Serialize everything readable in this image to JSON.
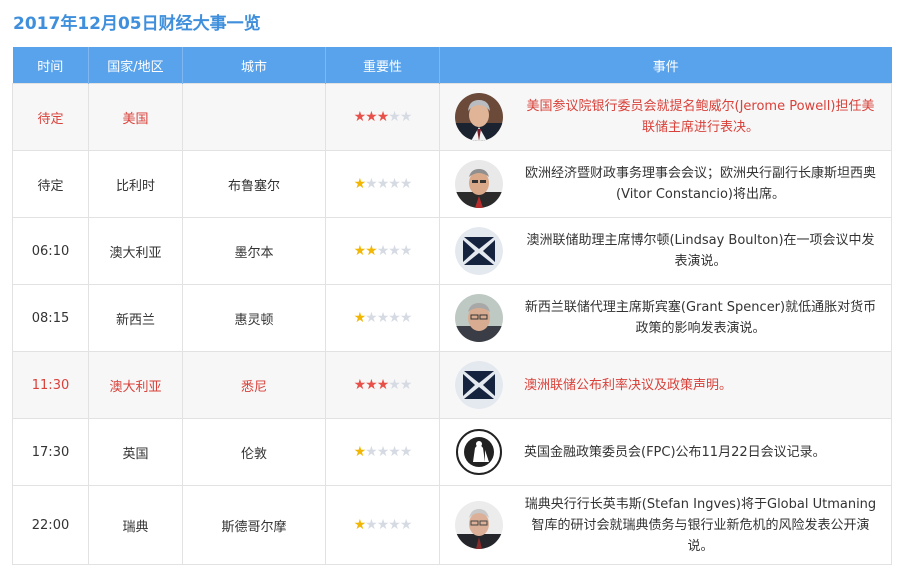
{
  "title": "2017年12月05日财经大事一览",
  "colors": {
    "header_bg": "#59a3ec",
    "title": "#3f8fdc",
    "highlight_text": "#d9413a",
    "star_on_red": "#e8514a",
    "star_on_gold": "#f2b705",
    "star_off": "#d6dbe3"
  },
  "headers": {
    "time": "时间",
    "country": "国家/地区",
    "city": "城市",
    "importance": "重要性",
    "event": "事件"
  },
  "rows": [
    {
      "time": "待定",
      "country": "美国",
      "city": "",
      "importance": 3,
      "highlight": true,
      "icon": "jerome-powell-portrait-icon",
      "event": "美国参议院银行委员会就提名鲍威尔(Jerome Powell)担任美联储主席进行表决。"
    },
    {
      "time": "待定",
      "country": "比利时",
      "city": "布鲁塞尔",
      "importance": 1,
      "highlight": false,
      "icon": "vitor-constancio-portrait-icon",
      "event": "欧洲经济暨财政事务理事会会议；欧洲央行副行长康斯坦西奥(Vitor Constancio)将出席。"
    },
    {
      "time": "06:10",
      "country": "澳大利亚",
      "city": "墨尔本",
      "importance": 2,
      "highlight": false,
      "icon": "rba-logo-icon",
      "event": "澳洲联储助理主席博尔顿(Lindsay Boulton)在一项会议中发表演说。"
    },
    {
      "time": "08:15",
      "country": "新西兰",
      "city": "惠灵顿",
      "importance": 1,
      "highlight": false,
      "icon": "grant-spencer-portrait-icon",
      "event": "新西兰联储代理主席斯宾塞(Grant Spencer)就低通胀对货币政策的影响发表演说。"
    },
    {
      "time": "11:30",
      "country": "澳大利亚",
      "city": "悉尼",
      "importance": 3,
      "highlight": true,
      "icon": "rba-logo-icon",
      "event": "澳洲联储公布利率决议及政策声明。"
    },
    {
      "time": "17:30",
      "country": "英国",
      "city": "伦敦",
      "importance": 1,
      "highlight": false,
      "icon": "boe-britannia-logo-icon",
      "event": "英国金融政策委员会(FPC)公布11月22日会议记录。"
    },
    {
      "time": "22:00",
      "country": "瑞典",
      "city": "斯德哥尔摩",
      "importance": 1,
      "highlight": false,
      "icon": "stefan-ingves-portrait-icon",
      "event": "瑞典央行行长英韦斯(Stefan Ingves)将于Global Utmaning智库的研讨会就瑞典债务与银行业新危机的风险发表公开演说。"
    }
  ]
}
